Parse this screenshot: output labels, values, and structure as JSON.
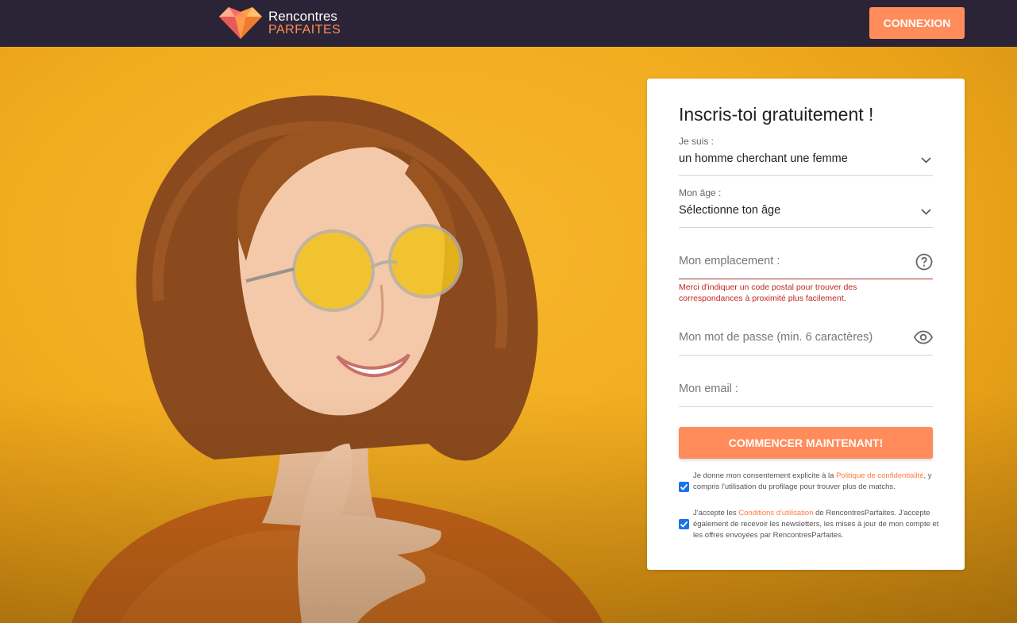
{
  "header": {
    "logo_line1": "Rencontres",
    "logo_line2": "PARFAITES",
    "login_label": "CONNEXION"
  },
  "form": {
    "title": "Inscris-toi gratuitement !",
    "gender": {
      "label": "Je suis :",
      "value": "un homme cherchant une femme"
    },
    "age": {
      "label": "Mon âge :",
      "value": "Sélectionne ton âge"
    },
    "location": {
      "placeholder": "Mon emplacement :",
      "error": "Merci d'indiquer un code postal pour trouver des correspondances à proximité plus facilement."
    },
    "password": {
      "placeholder": "Mon mot de passe (min. 6 caractères)"
    },
    "email": {
      "placeholder": "Mon email :"
    },
    "submit_label": "COMMENCER MAINTENANT!",
    "consent1": {
      "before": "Je donne mon consentement explicite à la ",
      "link": "Politique de confidentialité",
      "after": ", y compris l'utilisation du profilage pour trouver plus de matchs."
    },
    "consent2": {
      "before": "J'accepte les ",
      "link": "Conditions d'utilisation",
      "after": " de RencontresParfaites. J'accepte également de recevoir les newsletters, les mises à jour de mon compte et les offres envoyées par RencontresParfaites."
    }
  },
  "colors": {
    "accent": "#ff8c5a",
    "header_bg": "#2b2436",
    "error": "#c0271e",
    "checkbox": "#1a73e8"
  }
}
